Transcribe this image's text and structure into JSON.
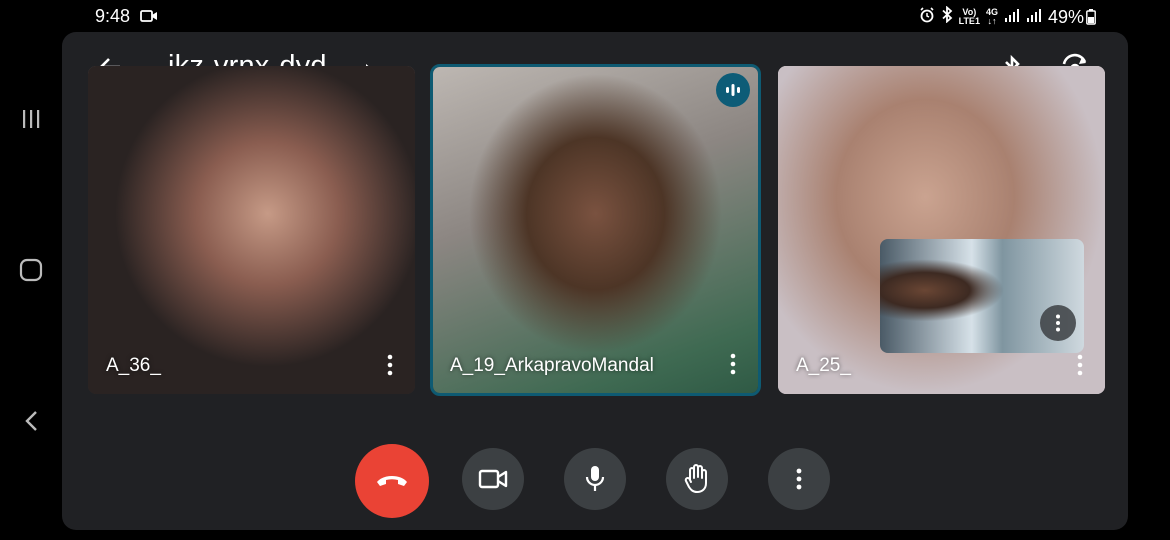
{
  "status_bar": {
    "time": "9:48",
    "network_volte": "Vo)",
    "network_lte": "LTE1",
    "network_4g": "4G",
    "battery_percent": "49%"
  },
  "meeting": {
    "code": "ikz-vrnx-dyd"
  },
  "participants": [
    {
      "name": "A_36_",
      "speaking": false
    },
    {
      "name": "A_19_ArkapravoMandal",
      "speaking": true
    },
    {
      "name": "A_25_",
      "speaking": false
    }
  ],
  "colors": {
    "end_call": "#ea4335",
    "control_bg": "#3c4043",
    "stage_bg": "#202124",
    "active_border": "#0e5a72"
  },
  "icons": [
    "back-arrow-icon",
    "caret-right-icon",
    "bluetooth-icon",
    "switch-camera-icon",
    "more-vert-icon",
    "speaking-icon",
    "hang-up-icon",
    "videocam-icon",
    "mic-icon",
    "raise-hand-icon"
  ]
}
